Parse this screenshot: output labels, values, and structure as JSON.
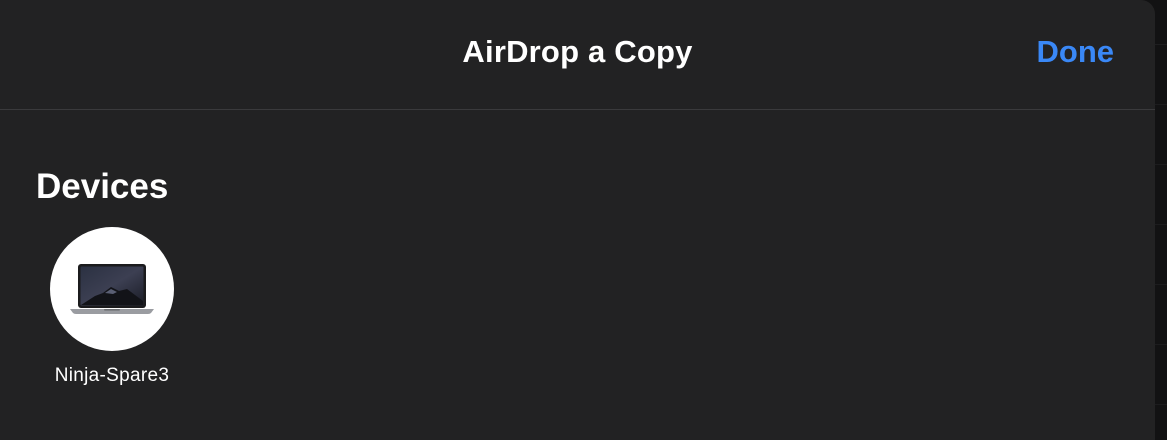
{
  "header": {
    "title": "AirDrop a Copy",
    "done_label": "Done"
  },
  "devices_section": {
    "title": "Devices",
    "items": [
      {
        "label": "Ninja-Spare3",
        "icon": "macbook-icon"
      }
    ]
  },
  "colors": {
    "sheet_background": "#222223",
    "accent": "#3a88f6",
    "text": "#ffffff",
    "divider": "#3a3a3c"
  }
}
